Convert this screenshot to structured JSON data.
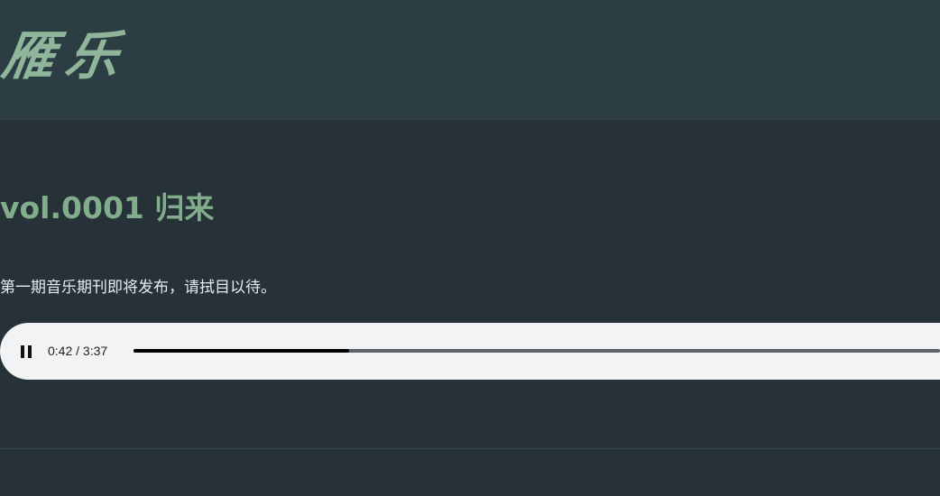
{
  "header": {
    "logo_text": "雁乐"
  },
  "issue": {
    "title": "vol.0001 归来",
    "description": "第一期音乐期刊即将发布，请拭目以待。"
  },
  "player": {
    "state": "playing",
    "play_pause_icon": "pause-icon",
    "current_time": "0:42",
    "duration": "3:37",
    "time_display": "0:42 / 3:37",
    "progress_fraction": 0.267
  },
  "colors": {
    "background": "#263238",
    "header_background": "#2d3d44",
    "accent_green": "#82ad8d",
    "player_background": "#f1f3f4"
  }
}
